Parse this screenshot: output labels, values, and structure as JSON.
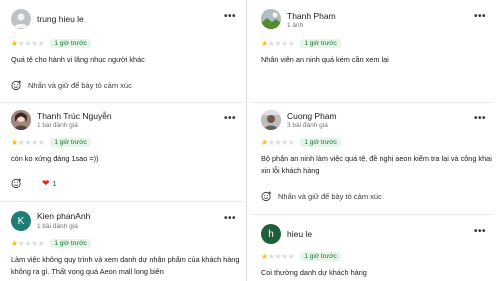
{
  "reviews_left": [
    {
      "name": "trung hieu le",
      "sub": "",
      "avatar": "gray-placeholder",
      "stars": 1,
      "time": "1 giờ trước",
      "text": "Quá tệ cho hành vi lăng nhục người khác",
      "reaction": "Nhấn và giữ để bày tỏ cảm xúc"
    },
    {
      "name": "Thanh Trúc Nguyễn",
      "sub": "1 bài đánh giá",
      "avatar": "photo",
      "stars": 1,
      "time": "1 giờ trước",
      "text": "còn ko xứng đáng 1sao =))",
      "heart_count": "1"
    },
    {
      "name": "Kien phanAnh",
      "sub": "1 bài đánh giá",
      "avatar_letter": "K",
      "avatar_color": "#1e7d74",
      "stars": 1,
      "time": "1 giờ trước",
      "text": "Làm việc không quy trình và xem danh dự nhân phẩm của khách hàng không ra gì. Thất vọng quá Aeon mall long biên"
    }
  ],
  "reviews_right": [
    {
      "name": "Thanh Pham",
      "sub": "1 ảnh",
      "avatar": "photo",
      "stars": 1,
      "time": "1 giờ trước",
      "text": "Nhân viên an ninh quá kém cần xem lại"
    },
    {
      "name": "Cuong Pham",
      "sub": "3 bài đánh giá",
      "avatar": "photo",
      "stars": 1,
      "time": "1 giờ trước",
      "text": "Bộ phận an ninh làm việc quá tệ, đề nghị aeon kiểm tra lại và công khai xin lỗi khách hàng",
      "reaction": "Nhấn và giữ để bày tỏ cảm xúc"
    },
    {
      "name": "hieu le",
      "sub": "",
      "avatar_letter": "h",
      "avatar_color": "#1e5e3a",
      "stars": 1,
      "time": "1 giờ trước",
      "text": "Coi thường danh dự khách hàng"
    }
  ],
  "more_icon": "more-horizontal-icon",
  "colors": {
    "star": "#fbbc04",
    "badge_bg": "#e6f4ea",
    "badge_text": "#137333",
    "heart": "#d93025"
  }
}
